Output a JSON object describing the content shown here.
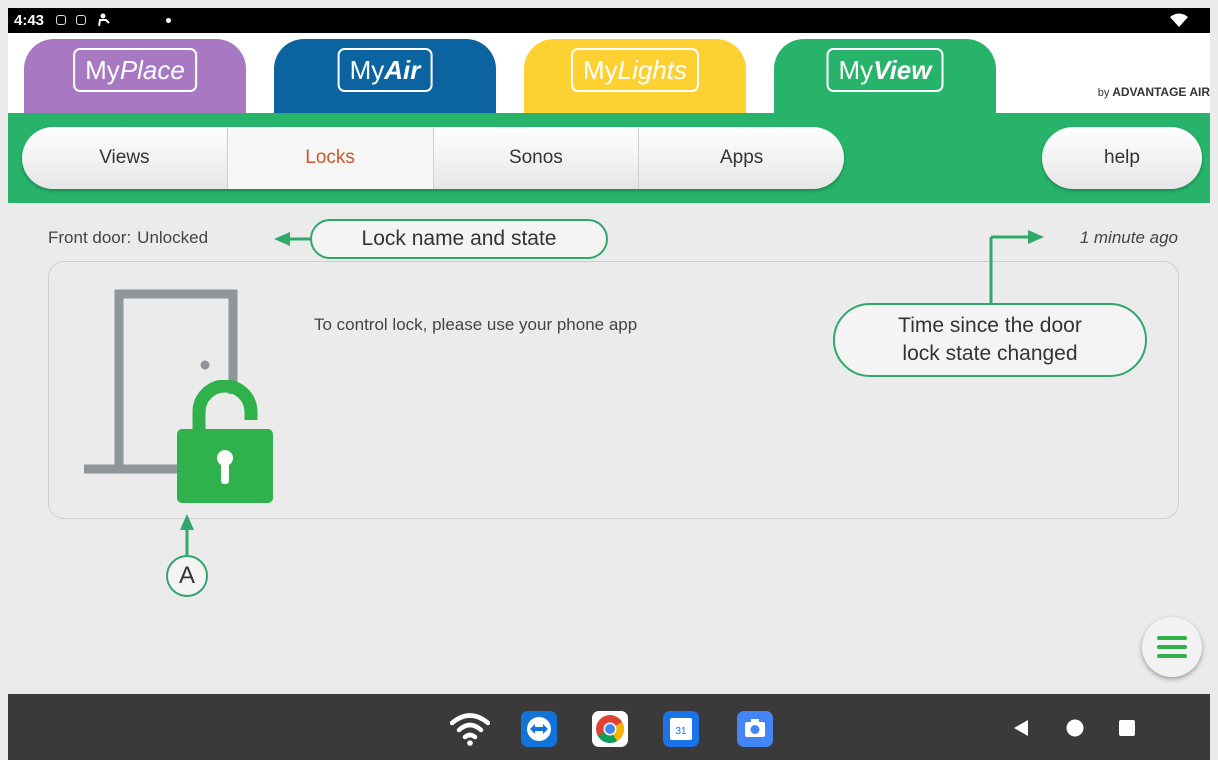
{
  "status_bar": {
    "time": "4:43"
  },
  "header": {
    "tabs": [
      {
        "prefix": "My",
        "name": "Place",
        "color": "#a879c2"
      },
      {
        "prefix": "My",
        "name": "Air",
        "color": "#0b64a0"
      },
      {
        "prefix": "My",
        "name": "Lights",
        "color": "#fdd132"
      },
      {
        "prefix": "My",
        "name": "View",
        "color": "#27b36a"
      }
    ],
    "brand_by": "by",
    "brand_name": "ADVANTAGE AIR"
  },
  "nav": {
    "segments": [
      "Views",
      "Locks",
      "Sonos",
      "Apps"
    ],
    "active": "Locks",
    "help_label": "help",
    "accent_color": "#c8582a",
    "band_color": "#27b36a"
  },
  "lock": {
    "name": "Front door",
    "separator": ":",
    "state": "Unlocked",
    "time_ago": "1 minute ago",
    "message": "To control lock, please use your phone app",
    "icon": "unlocked-padlock-icon",
    "icon_color": "#2fb24c"
  },
  "annotations": {
    "lock_name_callout": "Lock name and state",
    "time_callout_line1": "Time since the door",
    "time_callout_line2": "lock state changed",
    "marker_a": "A",
    "color": "#2fa86a"
  },
  "fab": {
    "icon": "menu-icon"
  },
  "bottom_bar": {
    "apps": [
      "wifi-icon",
      "teamviewer-icon",
      "chrome-icon",
      "calendar-icon",
      "camera-icon"
    ],
    "calendar_day": "31"
  }
}
